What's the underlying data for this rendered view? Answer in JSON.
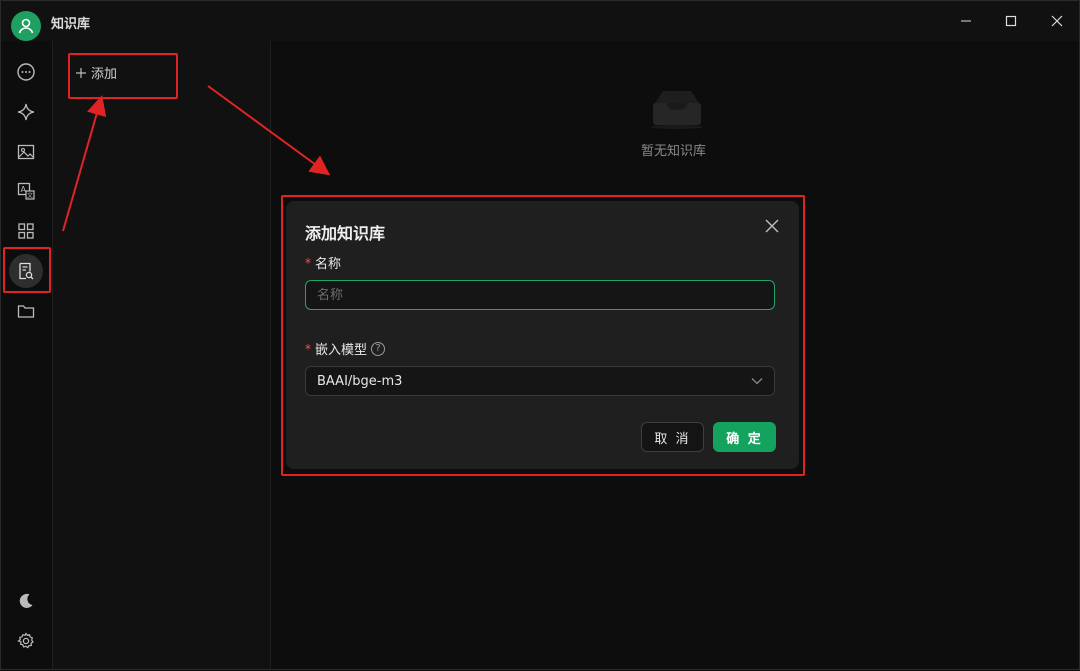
{
  "app": {
    "title": "知识库"
  },
  "window_controls": [
    "minimize",
    "maximize",
    "close"
  ],
  "sidebar": {
    "items": [
      {
        "name": "chat",
        "icon": "chat-bubble-icon"
      },
      {
        "name": "agents",
        "icon": "sparkle-icon"
      },
      {
        "name": "paintings",
        "icon": "image-icon"
      },
      {
        "name": "translate",
        "icon": "translate-icon"
      },
      {
        "name": "apps",
        "icon": "grid-icon"
      },
      {
        "name": "knowledge",
        "icon": "knowledge-base-icon",
        "active": true
      },
      {
        "name": "files",
        "icon": "folder-icon"
      }
    ],
    "bottom": [
      {
        "name": "theme",
        "icon": "moon-icon"
      },
      {
        "name": "settings",
        "icon": "gear-icon"
      }
    ]
  },
  "list_panel": {
    "add_label": "添加"
  },
  "main": {
    "empty_text": "暂无知识库"
  },
  "modal": {
    "title": "添加知识库",
    "name_label": "名称",
    "name_placeholder": "名称",
    "model_label": "嵌入模型",
    "model_value": "BAAI/bge-m3",
    "cancel_label": "取 消",
    "ok_label": "确 定",
    "required_mark": "*"
  },
  "colors": {
    "accent": "#13a35e",
    "annotation": "#e02424",
    "background": "#0d0d0d",
    "modal_bg": "#1f1f1f"
  }
}
